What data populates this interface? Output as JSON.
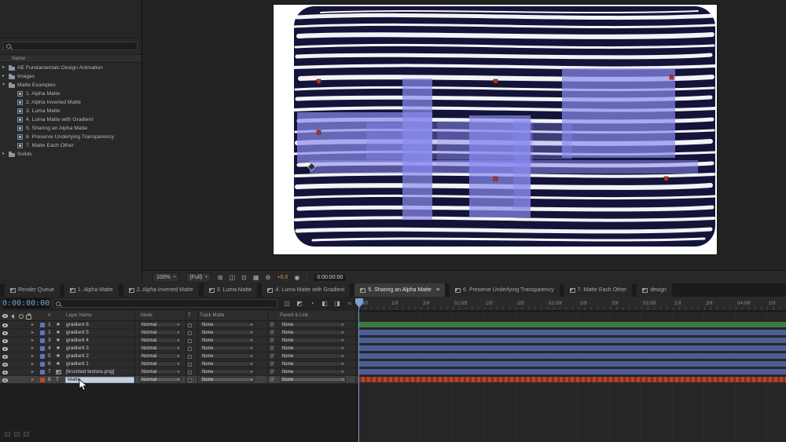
{
  "colors": {
    "timecode_accent": "#6fa8dc",
    "exposure_accent": "#d49a43",
    "playhead": "#7e9fd4",
    "canvas_paint": "#14143a",
    "canvas_overlay_blue": "#8a8aee"
  },
  "icons": {
    "twirl_closed": "▸",
    "twirl_open": "▾",
    "chevron": "▾",
    "star": "★",
    "text_layer": "T",
    "menu": "≡",
    "pickwhip": "@",
    "rq": "▤",
    "grid": "⊞",
    "mask": "◫",
    "roi": "⊡",
    "tgrid": "▦",
    "gear": "⚙",
    "camera": "◉",
    "flowchart": "◫",
    "draft": "◩",
    "shy": "◔",
    "frame_blend": "◧",
    "motion_blur": "◨",
    "graph": "≈",
    "sep": "|"
  },
  "project_panel": {
    "name_header": "Name",
    "items": [
      {
        "label": "AE Fundamentals Design Animation",
        "type": "folder"
      },
      {
        "label": "Images",
        "type": "folder"
      },
      {
        "label": "Matte Examples",
        "type": "folder",
        "expanded": true
      },
      {
        "label": "1. Alpha Matte",
        "type": "comp"
      },
      {
        "label": "2. Alpha Inverted Matte",
        "type": "comp"
      },
      {
        "label": "3. Luma Matte",
        "type": "comp"
      },
      {
        "label": "4. Luma Matte with Gradient",
        "type": "comp"
      },
      {
        "label": "5. Sharing an Alpha Matte",
        "type": "comp"
      },
      {
        "label": "6. Preserve Underlying Transparency",
        "type": "comp"
      },
      {
        "label": "7. Matte Each Other",
        "type": "comp"
      },
      {
        "label": "Solids",
        "type": "folder"
      }
    ]
  },
  "viewer": {
    "zoom": "100%",
    "resolution": "(Full)",
    "exposure": "+0.0",
    "timecode": "0:00:00:00"
  },
  "tabs": [
    {
      "label": "Render Queue",
      "active": false
    },
    {
      "label": "1. Alpha Matte",
      "active": false
    },
    {
      "label": "2. Alpha Inverted Matte",
      "active": false
    },
    {
      "label": "3. Luma Matte",
      "active": false
    },
    {
      "label": "4. Luma Matte with Gradient",
      "active": false
    },
    {
      "label": "5. Sharing an Alpha Matte",
      "active": true
    },
    {
      "label": "6. Preserve Underlying Transparency",
      "active": false
    },
    {
      "label": "7. Matte Each Other",
      "active": false
    },
    {
      "label": "design",
      "active": false
    }
  ],
  "timeline": {
    "current_time": "0:00:00:00",
    "headers": {
      "number": "#",
      "layer_name": "Layer Name",
      "mode": "Mode",
      "t": "T",
      "track_matte": "Track Matte",
      "parent": "Parent & Link"
    },
    "layers": [
      {
        "num": "1",
        "name": "gradient 6",
        "icon": "star",
        "mode": "Normal",
        "track_matte": "None",
        "parent": "None",
        "swatch": "#6272c4",
        "bar_color": "#3c7a44"
      },
      {
        "num": "2",
        "name": "gradient 5",
        "icon": "star",
        "mode": "Normal",
        "track_matte": "None",
        "parent": "None",
        "swatch": "#6272c4",
        "bar_color": "#4d5e96"
      },
      {
        "num": "3",
        "name": "gradient 4",
        "icon": "star",
        "mode": "Normal",
        "track_matte": "None",
        "parent": "None",
        "swatch": "#6272c4",
        "bar_color": "#4d5e96"
      },
      {
        "num": "4",
        "name": "gradient 3",
        "icon": "star",
        "mode": "Normal",
        "track_matte": "None",
        "parent": "None",
        "swatch": "#6272c4",
        "bar_color": "#4d5e96"
      },
      {
        "num": "5",
        "name": "gradient 2",
        "icon": "star",
        "mode": "Normal",
        "track_matte": "None",
        "parent": "None",
        "swatch": "#6272c4",
        "bar_color": "#4d5e96"
      },
      {
        "num": "6",
        "name": "gradient 1",
        "icon": "star",
        "mode": "Normal",
        "track_matte": "None",
        "parent": "None",
        "swatch": "#6272c4",
        "bar_color": "#4d5e96"
      },
      {
        "num": "7",
        "name": "[brushed texture.png]",
        "icon": "footage",
        "mode": "Normal",
        "track_matte": "None",
        "parent": "None",
        "swatch": "#6272c4",
        "bar_color": "#4d5e96"
      },
      {
        "num": "8",
        "name": "Matte",
        "icon": "text",
        "editing": true,
        "mode": "Normal",
        "track_matte": "None",
        "parent": "None",
        "swatch": "#bf4a30",
        "bar_color": "#b5412d"
      }
    ],
    "ruler": [
      ":00f",
      "10f",
      "20f",
      "01:00f",
      "10f",
      "20f",
      "02:00f",
      "10f",
      "20f",
      "03:00f",
      "10f",
      "20f",
      "04:00f",
      "10f"
    ]
  }
}
